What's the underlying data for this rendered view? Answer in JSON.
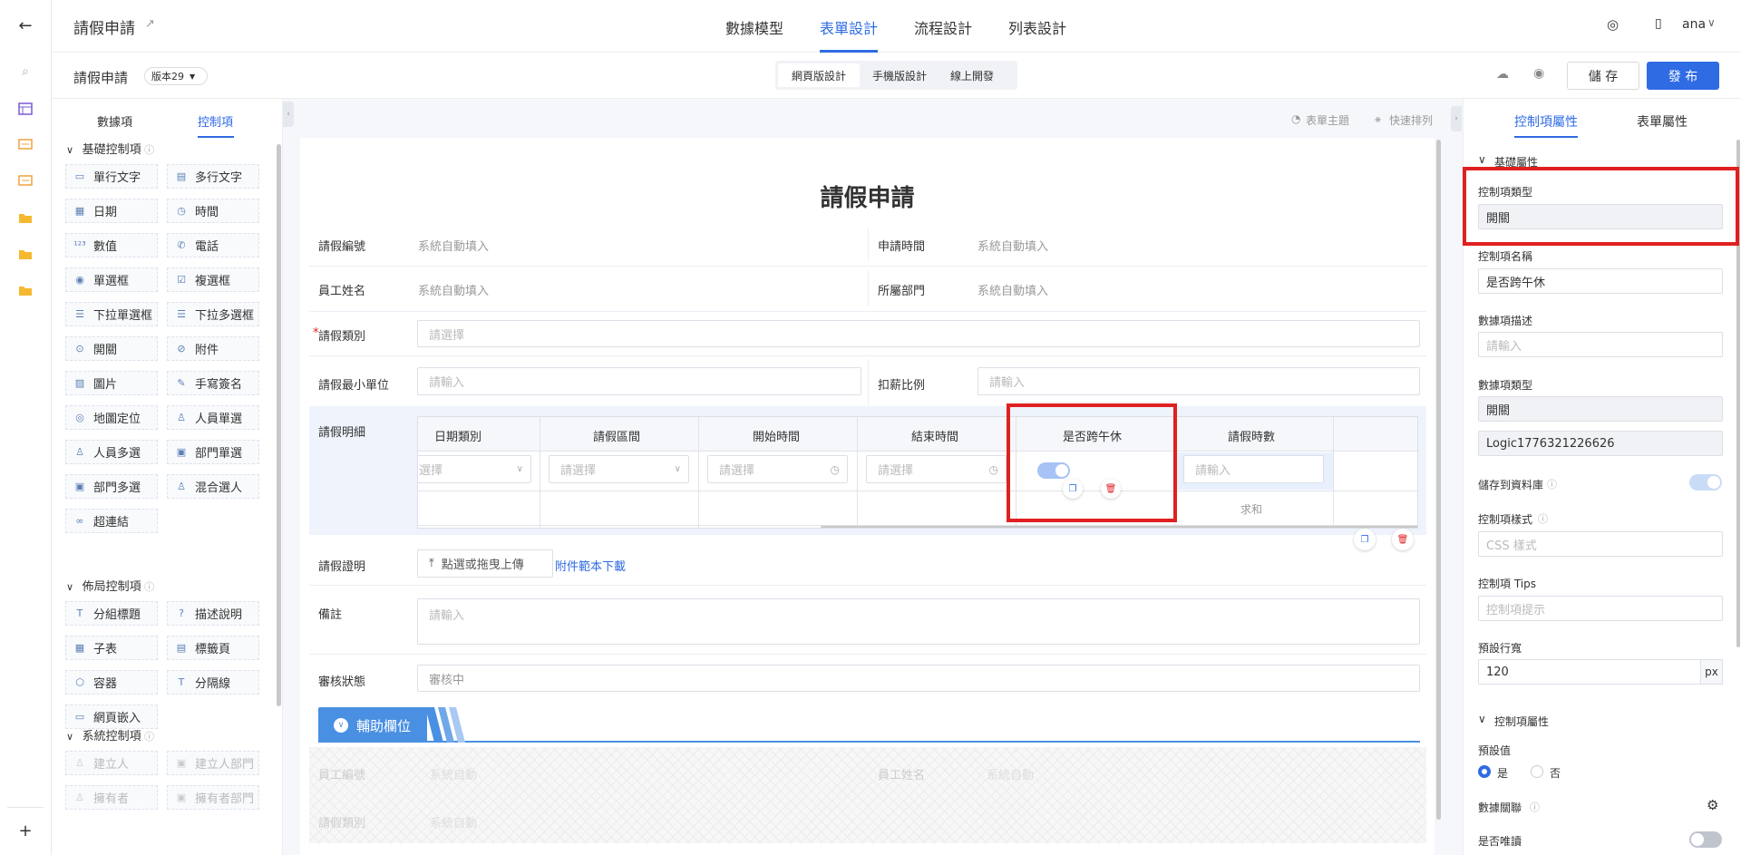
{
  "app": {
    "title": "請假申請",
    "user": "ana"
  },
  "nav": {
    "tabs": [
      "數據模型",
      "表單設計",
      "流程設計",
      "列表設計"
    ],
    "active": "表單設計"
  },
  "toolbar": {
    "form_name": "請假申請",
    "version": "版本29",
    "modes": [
      "網頁版設計",
      "手機版設計",
      "線上開發"
    ],
    "save": "儲 存",
    "publish": "發 布"
  },
  "left_panel": {
    "tabs": [
      "數據項",
      "控制項"
    ],
    "active_tab": "控制項",
    "sections": [
      {
        "title": "基礎控制項",
        "items": [
          {
            "label": "單行文字",
            "icon": "single-line-icon"
          },
          {
            "label": "多行文字",
            "icon": "multi-line-icon"
          },
          {
            "label": "日期",
            "icon": "calendar-icon"
          },
          {
            "label": "時間",
            "icon": "clock-icon"
          },
          {
            "label": "數值",
            "icon": "number-icon"
          },
          {
            "label": "電話",
            "icon": "phone-icon"
          },
          {
            "label": "單選框",
            "icon": "radio-icon"
          },
          {
            "label": "複選框",
            "icon": "checkbox-icon"
          },
          {
            "label": "下拉單選框",
            "icon": "dropdown-icon"
          },
          {
            "label": "下拉多選框",
            "icon": "dropdown-multi-icon"
          },
          {
            "label": "開關",
            "icon": "switch-icon"
          },
          {
            "label": "附件",
            "icon": "attachment-icon"
          },
          {
            "label": "圖片",
            "icon": "image-icon"
          },
          {
            "label": "手寫簽名",
            "icon": "pen-icon"
          },
          {
            "label": "地圖定位",
            "icon": "location-icon"
          },
          {
            "label": "人員單選",
            "icon": "person-icon"
          },
          {
            "label": "人員多選",
            "icon": "people-icon"
          },
          {
            "label": "部門單選",
            "icon": "dept-icon"
          },
          {
            "label": "部門多選",
            "icon": "dept-multi-icon"
          },
          {
            "label": "混合選人",
            "icon": "mixed-person-icon"
          },
          {
            "label": "超連結",
            "icon": "link-icon"
          }
        ]
      },
      {
        "title": "佈局控制項",
        "items": [
          {
            "label": "分組標題",
            "icon": "title-icon"
          },
          {
            "label": "描述說明",
            "icon": "help-icon"
          },
          {
            "label": "子表",
            "icon": "table-icon"
          },
          {
            "label": "標籤頁",
            "icon": "tabs-icon"
          },
          {
            "label": "容器",
            "icon": "container-icon"
          },
          {
            "label": "分隔線",
            "icon": "divider-icon"
          },
          {
            "label": "網頁嵌入",
            "icon": "embed-icon"
          }
        ]
      },
      {
        "title": "系統控制項",
        "items": [
          {
            "label": "建立人",
            "icon": "person-icon"
          },
          {
            "label": "建立人部門",
            "icon": "dept-icon"
          },
          {
            "label": "擁有者",
            "icon": "person-icon"
          },
          {
            "label": "擁有者部門",
            "icon": "dept-icon"
          }
        ]
      }
    ]
  },
  "canvas": {
    "theme": "表單主題",
    "arrange": "快速排列",
    "form_title": "請假申請",
    "fields": {
      "leave_no": {
        "label": "請假編號",
        "value": "系統自動填入"
      },
      "apply_time": {
        "label": "申請時間",
        "value": "系統自動填入"
      },
      "employee": {
        "label": "員工姓名",
        "value": "系統自動填入"
      },
      "dept": {
        "label": "所屬部門",
        "value": "系統自動填入"
      },
      "leave_type": {
        "label": "請假類別",
        "placeholder": "請選擇"
      },
      "min_unit": {
        "label": "請假最小單位",
        "placeholder": "請輸入"
      },
      "deduct": {
        "label": "扣薪比例",
        "placeholder": "請輸入"
      },
      "detail": {
        "label": "請假明細"
      },
      "proof": {
        "label": "請假證明",
        "upload": "點選或拖曳上傳",
        "template": "附件範本下載"
      },
      "remark": {
        "label": "備註",
        "placeholder": "請輸入"
      },
      "status": {
        "label": "審核狀態",
        "value": "審核中"
      },
      "aux": {
        "label": "輔助欄位"
      },
      "aux_emp_no": {
        "label": "員工編號",
        "value": "系統自動"
      },
      "aux_emp_name": {
        "label": "員工姓名",
        "value": "系統自動"
      },
      "aux_type": {
        "label": "請假類別",
        "value": "系統自動"
      }
    },
    "subtable": {
      "headers": [
        "日期類別",
        "請假區間",
        "開始時間",
        "結束時間",
        "是否跨午休",
        "請假時數"
      ],
      "placeholders": [
        "選擇",
        "請選擇",
        "請選擇",
        "請選擇",
        "",
        "請輸入"
      ],
      "sum_label": "求和"
    }
  },
  "right_panel": {
    "tabs": [
      "控制項屬性",
      "表單屬性"
    ],
    "active_tab": "控制項屬性",
    "basic_section": "基礎屬性",
    "ctrl_type_label": "控制項類型",
    "ctrl_type": "開關",
    "ctrl_name_label": "控制項名稱",
    "ctrl_name": "是否跨午休",
    "data_desc_label": "數據項描述",
    "data_desc_placeholder": "請輸入",
    "data_type_label": "數據項類型",
    "data_type": "開關",
    "data_code": "Logic1776321226626",
    "store_db_label": "儲存到資料庫",
    "style_label": "控制項樣式",
    "style_placeholder": "CSS 樣式",
    "tips_label": "控制項 Tips",
    "tips_placeholder": "控制項提示",
    "width_label": "預設行寬",
    "width_value": "120",
    "width_unit": "px",
    "ctrl_attr_section": "控制項屬性",
    "default_label": "預設值",
    "default_yes": "是",
    "default_no": "否",
    "data_link_label": "數據關聯",
    "readonly_label": "是否唯讀"
  }
}
